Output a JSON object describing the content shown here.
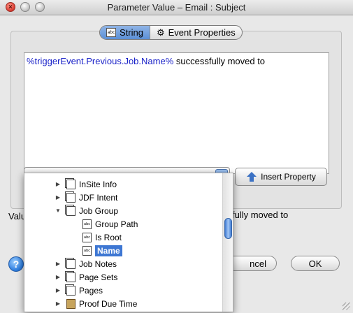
{
  "window": {
    "title": "Parameter Value – Email : Subject"
  },
  "tabs": [
    {
      "label": "String",
      "icon": "abc-string-icon",
      "active": true
    },
    {
      "label": "Event Properties",
      "icon": "gear-icon",
      "active": false
    }
  ],
  "editor": {
    "token": "%triggerEvent.Previous.Job.Name%",
    "text": " successfully moved to"
  },
  "insert_button": {
    "label": "Insert Property"
  },
  "value_row": {
    "label": "Valu",
    "text": "fully moved to"
  },
  "help": {
    "label": "?"
  },
  "cancel_button": {
    "label": "ncel"
  },
  "ok_button": {
    "label": "OK"
  },
  "tree": [
    {
      "label": "InSite Info",
      "icon": "stack-document-icon",
      "expander": "right"
    },
    {
      "label": "JDF Intent",
      "icon": "stack-document-icon",
      "expander": "right"
    },
    {
      "label": "Job Group",
      "icon": "stack-document-icon",
      "expander": "down"
    },
    {
      "label": "Group Path",
      "icon": "abc-field-icon",
      "expander": "none"
    },
    {
      "label": "Is Root",
      "icon": "abc-field-icon",
      "expander": "none"
    },
    {
      "label": "Name",
      "icon": "abc-field-icon",
      "expander": "none",
      "selected": true
    },
    {
      "label": "Job Notes",
      "icon": "stack-document-icon",
      "expander": "right"
    },
    {
      "label": "Page Sets",
      "icon": "stack-document-icon",
      "expander": "right"
    },
    {
      "label": "Pages",
      "icon": "stack-document-icon",
      "expander": "right"
    },
    {
      "label": "Proof Due Time",
      "icon": "calendar-icon",
      "expander": "right"
    }
  ],
  "colors": {
    "accent": "#3e77d3",
    "token": "#1a22c8"
  }
}
